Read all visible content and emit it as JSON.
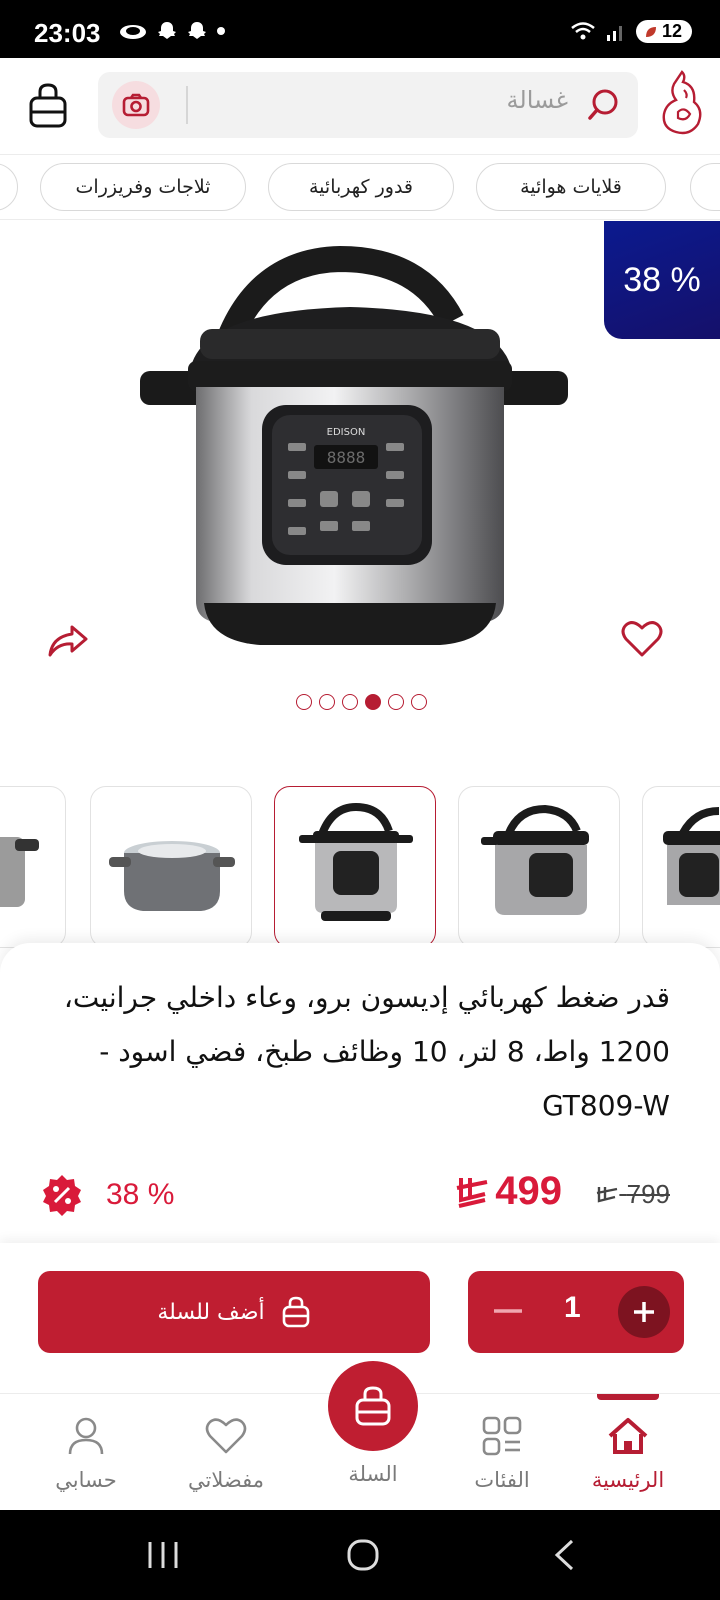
{
  "status_bar": {
    "time": "23:03",
    "battery": "12"
  },
  "header": {
    "search_placeholder": "غسالة",
    "icons": [
      "shopping-bag-icon",
      "camera-icon",
      "search-icon",
      "brand-logo"
    ]
  },
  "categories": [
    "قلايات هوائية",
    "قدور كهربائية",
    "ثلاجات وفريزرات"
  ],
  "gallery": {
    "discount_label": "38 %",
    "dots_count": 6,
    "active_dot": 4
  },
  "product": {
    "title": "قدر ضغط كهربائي إديسون برو، وعاء داخلي جرانيت، 1200 واط، 8 لتر، 10 وظائف طبخ، فضي اسود - GT809-W",
    "price": "499",
    "old_price": "799",
    "discount": "38 %"
  },
  "actions": {
    "add_to_cart": "أضف للسلة",
    "quantity": "1"
  },
  "bottom_nav": {
    "home": "الرئيسية",
    "categories": "الفئات",
    "cart": "السلة",
    "favorites": "مفضلاتي",
    "account": "حسابي"
  },
  "colors": {
    "brand": "#bf1e31",
    "price": "#d91a3a",
    "discount_corner": "#0b1a8f"
  }
}
